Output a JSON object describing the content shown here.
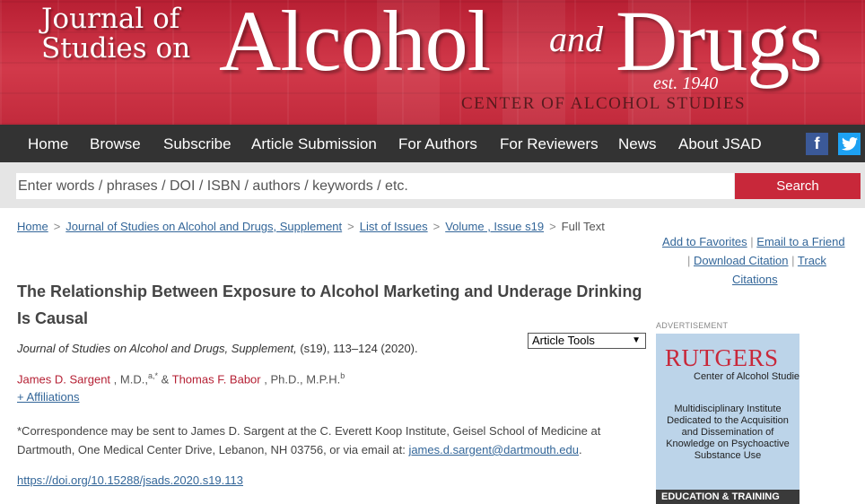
{
  "banner": {
    "journal_line1": "Journal of",
    "journal_line2": "Studies on",
    "word_alcohol": "Alcohol",
    "word_and": "and",
    "word_drugs": "Drugs",
    "established": "est. 1940",
    "center": "CENTER OF ALCOHOL STUDIES"
  },
  "nav": {
    "items": [
      "Home",
      "Browse",
      "Subscribe",
      "Article Submission",
      "For Authors",
      "For Reviewers",
      "News",
      "About JSAD"
    ],
    "facebook_icon": "f",
    "twitter_icon": "🐦"
  },
  "search": {
    "placeholder": "Enter words / phrases / DOI / ISBN / authors / keywords / etc.",
    "button_label": "Search"
  },
  "breadcrumb": {
    "items": [
      "Home",
      "Journal of Studies on Alcohol and Drugs, Supplement",
      "List of Issues",
      "Volume , Issue s19"
    ],
    "current": "Full Text",
    "separator": ">"
  },
  "right_links": {
    "add_favorites": "Add to Favorites",
    "email_friend": "Email to a Friend",
    "download_citation": "Download Citation",
    "track_citations_1": "Track",
    "track_citations_2": "Citations"
  },
  "advertisement": {
    "label": "ADVERTISEMENT",
    "brand": "RUTGERS",
    "subtitle": "Center of Alcohol Studies",
    "body": "Multidisciplinary Institute Dedicated to the Acquisition and Dissemination of Knowledge on Psychoactive Substance Use",
    "footer": "EDUCATION & TRAINING"
  },
  "article": {
    "title": "The Relationship Between Exposure to Alcohol Marketing and Underage Drinking Is Causal",
    "tools_label": "Article Tools",
    "citation": "Journal of Studies on Alcohol and Drugs, Supplement, (s19), 113–124 (2020).",
    "citation_journal": "Journal of Studies on Alcohol and Drugs, Supplement,",
    "citation_rest": " (s19), 113–124 (2020).",
    "author1_name": "James D. Sargent",
    "author1_degree": " , M.D.,",
    "author1_sup": "a,*",
    "amp": " & ",
    "author2_name": "Thomas F. Babor",
    "author2_degree": " , Ph.D., M.P.H.",
    "author2_sup": "b",
    "affiliations": "+ Affiliations",
    "correspondence": "*Correspondence may be sent to James D. Sargent at the C. Everett Koop Institute, Geisel School of Medicine at Dartmouth, One Medical Center Drive, Lebanon, NH 03756, or via email at: ",
    "email": "james.d.sargent@dartmouth.edu",
    "correspondence_end": ".",
    "doi": "https://doi.org/10.15288/jsads.2020.s19.113"
  }
}
